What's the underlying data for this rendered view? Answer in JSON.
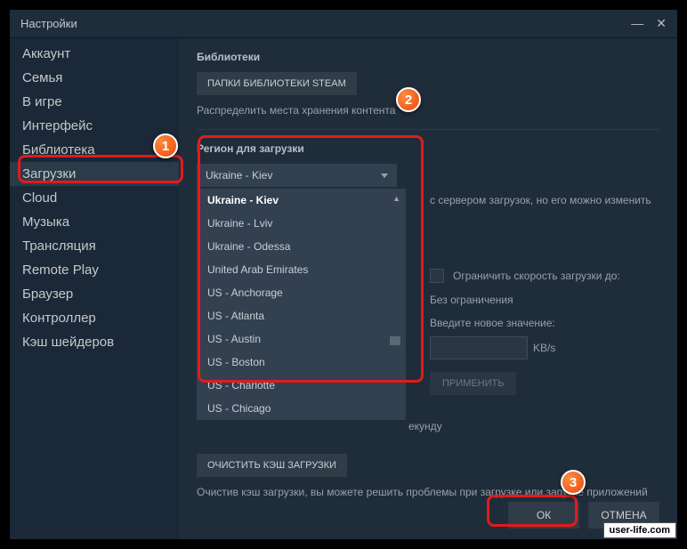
{
  "window": {
    "title": "Настройки"
  },
  "sidebar": {
    "items": [
      {
        "label": "Аккаунт"
      },
      {
        "label": "Семья"
      },
      {
        "label": "В игре"
      },
      {
        "label": "Интерфейс"
      },
      {
        "label": "Библиотека"
      },
      {
        "label": "Загрузки"
      },
      {
        "label": "Cloud"
      },
      {
        "label": "Музыка"
      },
      {
        "label": "Трансляция"
      },
      {
        "label": "Remote Play"
      },
      {
        "label": "Браузер"
      },
      {
        "label": "Контроллер"
      },
      {
        "label": "Кэш шейдеров"
      }
    ],
    "active_index": 5
  },
  "libraries": {
    "title": "Библиотеки",
    "button": "ПАПКИ БИБЛИОТЕКИ STEAM",
    "desc": "Распределить места хранения контента"
  },
  "region": {
    "title": "Регион для загрузки",
    "selected": "Ukraine - Kiev",
    "options": [
      "Ukraine - Kiev",
      "Ukraine - Lviv",
      "Ukraine - Odessa",
      "United Arab Emirates",
      "US - Anchorage",
      "US - Atlanta",
      "US - Austin",
      "US - Boston",
      "US - Charlotte",
      "US - Chicago"
    ],
    "hint_tail": "с сервером загрузок, но его можно изменить"
  },
  "limit": {
    "checkbox_label": "Ограничить скорость загрузки до:",
    "no_limit": "Без ограничения",
    "enter_new": "Введите новое значение:",
    "unit": "KB/s",
    "apply": "ПРИМЕНИТЬ",
    "tail": "екунду"
  },
  "clear": {
    "button": "ОЧИСТИТЬ КЭШ ЗАГРУЗКИ",
    "desc": "Очистив кэш загрузки, вы можете решить проблемы при загрузке или запуске приложений"
  },
  "footer": {
    "ok": "ОК",
    "cancel": "ОТМЕНА"
  },
  "markers": {
    "m1": "1",
    "m2": "2",
    "m3": "3"
  },
  "watermark": "user-life.com"
}
